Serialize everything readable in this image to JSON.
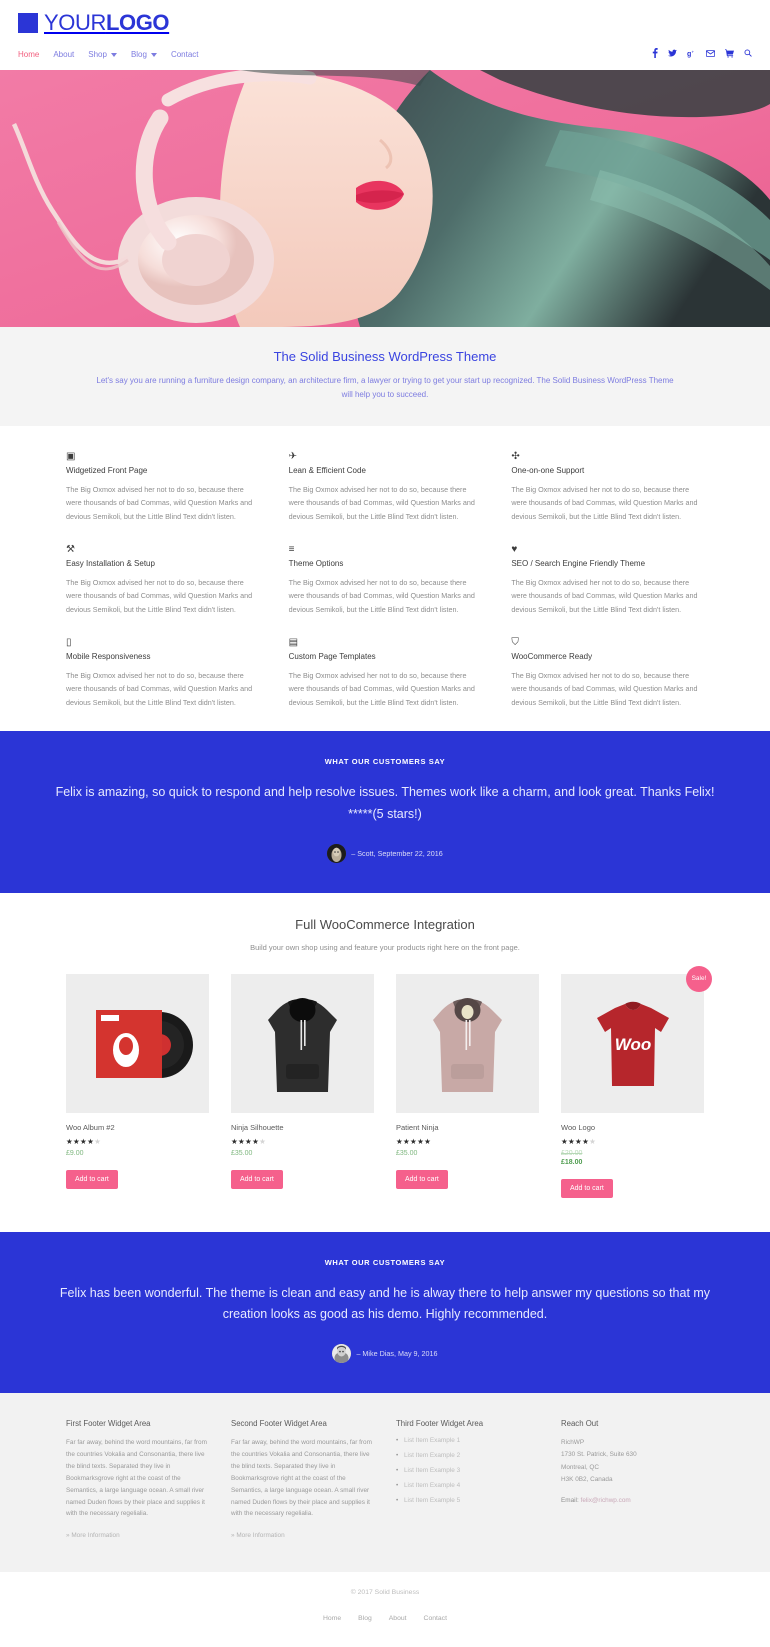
{
  "header": {
    "logo_text_light": "YOUR",
    "logo_text_bold": "LOGO",
    "nav": [
      {
        "label": "Home",
        "active": true,
        "caret": false
      },
      {
        "label": "About",
        "active": false,
        "caret": false
      },
      {
        "label": "Shop",
        "active": false,
        "caret": true
      },
      {
        "label": "Blog",
        "active": false,
        "caret": true
      },
      {
        "label": "Contact",
        "active": false,
        "caret": false
      }
    ],
    "social": [
      {
        "name": "facebook-icon",
        "glyph": "f"
      },
      {
        "name": "twitter-icon",
        "glyph": "t"
      },
      {
        "name": "google-plus-icon",
        "glyph": "g"
      },
      {
        "name": "email-icon",
        "glyph": "m"
      },
      {
        "name": "cart-icon",
        "glyph": "c"
      },
      {
        "name": "search-icon",
        "glyph": "s"
      }
    ],
    "brand_color": "#2b35d6",
    "active_link_color": "#f2607f"
  },
  "hero": {
    "alt": "Woman with pink headphones on pink background"
  },
  "intro": {
    "title": "The Solid Business WordPress Theme",
    "text": "Let's say you are running a furniture design company, an architecture firm, a lawyer or trying to get your start up recognized. The Solid Business WordPress Theme will help you to succeed."
  },
  "features": [
    {
      "icon": "▣",
      "icon_name": "widget-icon",
      "title": "Widgetized Front Page",
      "text": "The Big Oxmox advised her not to do so, because there were thousands of bad Commas, wild Question Marks and devious Semikoli, but the Little Blind Text didn't listen."
    },
    {
      "icon": "✈",
      "icon_name": "rocket-icon",
      "title": "Lean & Efficient Code",
      "text": "The Big Oxmox advised her not to do so, because there were thousands of bad Commas, wild Question Marks and devious Semikoli, but the Little Blind Text didn't listen."
    },
    {
      "icon": "✣",
      "icon_name": "support-icon",
      "title": "One-on-one Support",
      "text": "The Big Oxmox advised her not to do so, because there were thousands of bad Commas, wild Question Marks and devious Semikoli, but the Little Blind Text didn't listen."
    },
    {
      "icon": "⚒",
      "icon_name": "wrench-icon",
      "title": "Easy Installation & Setup",
      "text": "The Big Oxmox advised her not to do so, because there were thousands of bad Commas, wild Question Marks and devious Semikoli, but the Little Blind Text didn't listen."
    },
    {
      "icon": "≡",
      "icon_name": "sliders-icon",
      "title": "Theme Options",
      "text": "The Big Oxmox advised her not to do so, because there were thousands of bad Commas, wild Question Marks and devious Semikoli, but the Little Blind Text didn't listen."
    },
    {
      "icon": "♥",
      "icon_name": "heart-icon",
      "title": "SEO / Search Engine Friendly Theme",
      "text": "The Big Oxmox advised her not to do so, because there were thousands of bad Commas, wild Question Marks and devious Semikoli, but the Little Blind Text didn't listen."
    },
    {
      "icon": "▯",
      "icon_name": "mobile-icon",
      "title": "Mobile Responsiveness",
      "text": "The Big Oxmox advised her not to do so, because there were thousands of bad Commas, wild Question Marks and devious Semikoli, but the Little Blind Text didn't listen."
    },
    {
      "icon": "▤",
      "icon_name": "page-template-icon",
      "title": "Custom Page Templates",
      "text": "The Big Oxmox advised her not to do so, because there were thousands of bad Commas, wild Question Marks and devious Semikoli, but the Little Blind Text didn't listen."
    },
    {
      "icon": "⛉",
      "icon_name": "shopping-cart-icon",
      "title": "WooCommerce Ready",
      "text": "The Big Oxmox advised her not to do so, because there were thousands of bad Commas, wild Question Marks and devious Semikoli, but the Little Blind Text didn't listen."
    }
  ],
  "testimonial_one": {
    "kicker": "WHAT OUR CUSTOMERS SAY",
    "quote": "Felix is amazing, so quick to respond and help resolve issues. Themes work like a charm, and look great. Thanks Felix! *****(5 stars!)",
    "author": "– Scott, September 22, 2016",
    "bg_color": "#2b35d6"
  },
  "shop": {
    "title": "Full WooCommerce Integration",
    "subtitle": "Build your own shop using and feature your products right here on the front page.",
    "add_to_cart_label": "Add to cart",
    "sale_badge_label": "Sale!",
    "products": [
      {
        "name": "Woo Album #2",
        "rating": 4,
        "price": "£9.00",
        "old_price": null,
        "sale_price": null,
        "on_sale": false,
        "image": "vinyl-record-red-sleeve"
      },
      {
        "name": "Ninja Silhouette",
        "rating": 4,
        "price": "£35.00",
        "old_price": null,
        "sale_price": null,
        "on_sale": false,
        "image": "black-hoodie"
      },
      {
        "name": "Patient Ninja",
        "rating": 5,
        "price": "£35.00",
        "old_price": null,
        "sale_price": null,
        "on_sale": false,
        "image": "pink-hoodie"
      },
      {
        "name": "Woo Logo",
        "rating": 4,
        "price": null,
        "old_price": "£20.00",
        "sale_price": "£18.00",
        "on_sale": true,
        "image": "red-woo-tshirt"
      }
    ]
  },
  "testimonial_two": {
    "kicker": "WHAT OUR CUSTOMERS SAY",
    "quote": "Felix has been wonderful. The theme is clean and easy and he is alway there to help answer my questions so that my creation looks as good as his demo. Highly recommended.",
    "author": "– Mike Dias, May 9, 2016",
    "bg_color": "#2b35d6"
  },
  "footer_widgets": {
    "col1": {
      "title": "First Footer Widget Area",
      "text": "Far far away, behind the word mountains, far from the countries Vokalia and Consonantia, there live the blind texts. Separated they live in Bookmarksgrove right at the coast of the Semantics, a large language ocean. A small river named Duden flows by their place and supplies it with the necessary regelialia.",
      "more_label": "» More Information"
    },
    "col2": {
      "title": "Second Footer Widget Area",
      "text": "Far far away, behind the word mountains, far from the countries Vokalia and Consonantia, there live the blind texts. Separated they live in Bookmarksgrove right at the coast of the Semantics, a large language ocean. A small river named Duden flows by their place and supplies it with the necessary regelialia.",
      "more_label": "» More Information"
    },
    "col3": {
      "title": "Third Footer Widget Area",
      "items": [
        "List Item Example 1",
        "List Item Example 2",
        "List Item Example 3",
        "List Item Example 4",
        "List Item Example 5"
      ]
    },
    "col4": {
      "title": "Reach Out",
      "address": [
        "RichWP",
        "1730 St. Patrick, Suite 630",
        "Montreal, QC",
        "H3K 0B2, Canada"
      ],
      "email_label": "Email:",
      "email_value": "felix@richwp.com"
    }
  },
  "footer_bottom": {
    "copyright_mark": "© 2017 ",
    "copyright_name": "Solid Business",
    "nav": [
      "Home",
      "Blog",
      "About",
      "Contact"
    ]
  }
}
